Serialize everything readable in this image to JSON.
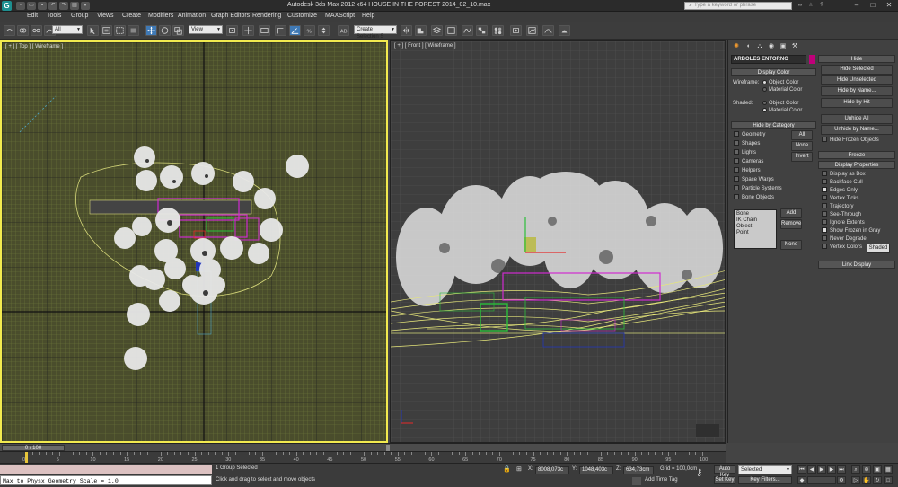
{
  "app": {
    "title": "Autodesk 3ds Max  2012 x64       HOUSE IN THE FOREST 2014_02_10.max",
    "search_placeholder": "Type a keyword or phrase"
  },
  "menu": [
    "Edit",
    "Tools",
    "Group",
    "Views",
    "Create",
    "Modifiers",
    "Animation",
    "Graph Editors",
    "Rendering",
    "Customize",
    "MAXScript",
    "Help"
  ],
  "toolbar": {
    "selection_filter": "All",
    "reference_coord": "View",
    "named_selection": "Create Selection S"
  },
  "viewports": {
    "top_label": "[ + ] [ Top ] [ Wireframe ]",
    "front_label": "[ + ] [ Front ] [ Wireframe ]"
  },
  "command_panel": {
    "object_name": "ARBOLES ENTORNO",
    "object_color": "#c0007a",
    "display_color": {
      "title": "Display Color",
      "wireframe_label": "Wireframe:",
      "shaded_label": "Shaded:",
      "object_color": "Object Color",
      "material_color": "Material Color"
    },
    "hide_by_category": {
      "title": "Hide by Category",
      "items": [
        {
          "label": "Geometry",
          "checked": false
        },
        {
          "label": "Shapes",
          "checked": false
        },
        {
          "label": "Lights",
          "checked": false
        },
        {
          "label": "Cameras",
          "checked": false
        },
        {
          "label": "Helpers",
          "checked": false
        },
        {
          "label": "Space Warps",
          "checked": false
        },
        {
          "label": "Particle Systems",
          "checked": false
        },
        {
          "label": "Bone Objects",
          "checked": false
        }
      ],
      "btn_all": "All",
      "btn_none": "None",
      "btn_invert": "Invert",
      "list_items": [
        "Bone",
        "IK Chain Object",
        "Point"
      ],
      "btn_add": "Add",
      "btn_remove": "Remove",
      "btn_none2": "None"
    },
    "hide": {
      "title": "Hide",
      "buttons": [
        "Hide Selected",
        "Hide Unselected",
        "Hide by Name...",
        "Hide by Hit",
        "Unhide All",
        "Unhide by Name..."
      ],
      "hide_frozen": "Hide Frozen Objects"
    },
    "freeze": {
      "title": "Freeze"
    },
    "display_properties": {
      "title": "Display Properties",
      "items": [
        {
          "label": "Display as Box",
          "checked": false
        },
        {
          "label": "Backface Cull",
          "checked": false
        },
        {
          "label": "Edges Only",
          "checked": true
        },
        {
          "label": "Vertex Ticks",
          "checked": false
        },
        {
          "label": "Trajectory",
          "checked": false
        },
        {
          "label": "See-Through",
          "checked": false
        },
        {
          "label": "Ignore Extents",
          "checked": false
        },
        {
          "label": "Show Frozen in Gray",
          "checked": true
        },
        {
          "label": "Never Degrade",
          "checked": false
        },
        {
          "label": "Vertex Colors",
          "checked": false
        }
      ],
      "shaded_btn": "Shaded"
    },
    "link_display": {
      "title": "Link Display"
    }
  },
  "timeline": {
    "slider_label": "0 / 100",
    "ticks": [
      "0",
      "5",
      "10",
      "15",
      "20",
      "25",
      "30",
      "35",
      "40",
      "45",
      "50",
      "55",
      "60",
      "65",
      "70",
      "75",
      "80",
      "85",
      "90",
      "95",
      "100"
    ]
  },
  "status": {
    "maxscript_output": "Max to Physx Geometry Scale = 1.0",
    "selection": "1 Group Selected",
    "prompt": "Click and drag to select and move objects",
    "x_label": "X:",
    "x_value": "8008,073c",
    "y_label": "Y:",
    "y_value": "1048,403c",
    "z_label": "Z:",
    "z_value": "634,73cm",
    "grid": "Grid = 100,0cm",
    "add_time_tag": "Add Time Tag",
    "auto_key": "Auto Key",
    "set_key": "Set Key",
    "key_mode": "Selected",
    "key_filters": "Key Filters..."
  }
}
